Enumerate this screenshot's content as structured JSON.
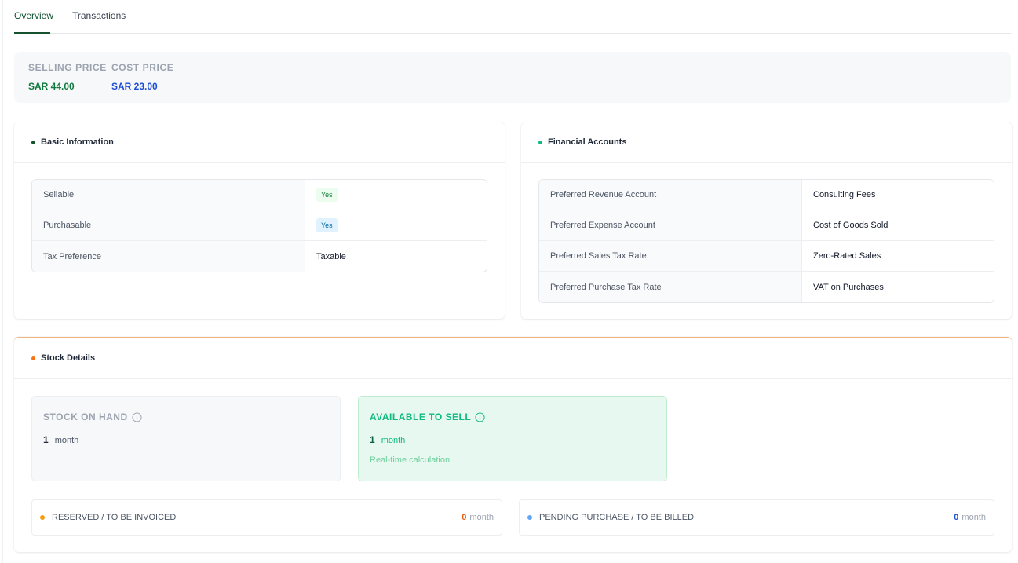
{
  "tabs": [
    {
      "label": "Overview",
      "active": true
    },
    {
      "label": "Transactions",
      "active": false
    }
  ],
  "prices": {
    "selling": {
      "label": "SELLING PRICE",
      "value": "SAR 44.00",
      "color": "#0f7a3e"
    },
    "cost": {
      "label": "COST PRICE",
      "value": "SAR 23.00",
      "color": "#1d4ed8"
    }
  },
  "basic_info": {
    "title": "Basic Information",
    "rows": [
      {
        "key": "Sellable",
        "value": "Yes"
      },
      {
        "key": "Purchasable",
        "value": "Yes"
      },
      {
        "key": "Tax Preference",
        "value": "Taxable"
      }
    ]
  },
  "financial_accounts": {
    "title": "Financial Accounts",
    "rows": [
      {
        "key": "Preferred Revenue Account",
        "value": "Consulting Fees"
      },
      {
        "key": "Preferred Expense Account",
        "value": "Cost of Goods Sold"
      },
      {
        "key": "Preferred Sales Tax Rate",
        "value": "Zero-Rated Sales"
      },
      {
        "key": "Preferred Purchase Tax Rate",
        "value": "VAT on Purchases"
      }
    ]
  },
  "stock": {
    "title": "Stock Details",
    "on_hand": {
      "label": "STOCK ON HAND",
      "value": "1",
      "unit": "month",
      "icon": "info-icon"
    },
    "available": {
      "label": "AVAILABLE TO SELL",
      "value": "1",
      "unit": "month",
      "note": "Real-time calculation",
      "icon": "info-icon"
    },
    "reserved": {
      "label": "RESERVED / TO BE INVOICED",
      "value": "0",
      "unit": "month"
    },
    "pending": {
      "label": "PENDING PURCHASE / TO BE BILLED",
      "value": "0",
      "unit": "month"
    }
  }
}
